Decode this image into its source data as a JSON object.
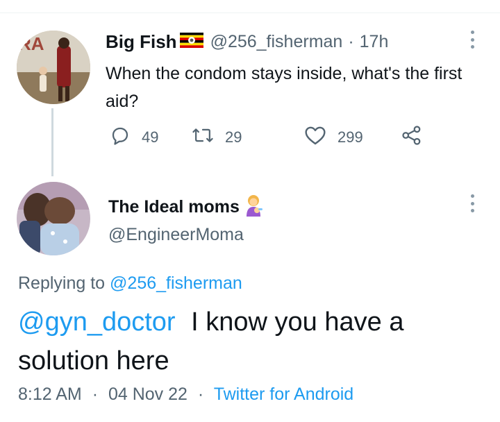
{
  "parent_tweet": {
    "author_name": "Big Fish",
    "flag_icon": "uganda-flag-icon",
    "handle": "@256_fisherman",
    "separator": "·",
    "time_ago": "17h",
    "text": "When the condom stays inside, what's the first aid?",
    "actions": {
      "reply_count": "49",
      "retweet_count": "29",
      "like_count": "299"
    }
  },
  "reply_tweet": {
    "author_name": "The Ideal moms",
    "author_emoji": "woman-feeding-baby-emoji",
    "handle": "@EngineerMoma",
    "replying_prefix": "Replying to",
    "replying_to": "@256_fisherman",
    "mention": "@gyn_doctor",
    "text": "I know you have a solution here",
    "time": "8:12 AM",
    "separator": "·",
    "date": "04 Nov 22",
    "source": "Twitter for Android"
  },
  "colors": {
    "link_blue": "#1d9bf0",
    "secondary_text": "#536471",
    "thread_line": "#cfd9de"
  }
}
